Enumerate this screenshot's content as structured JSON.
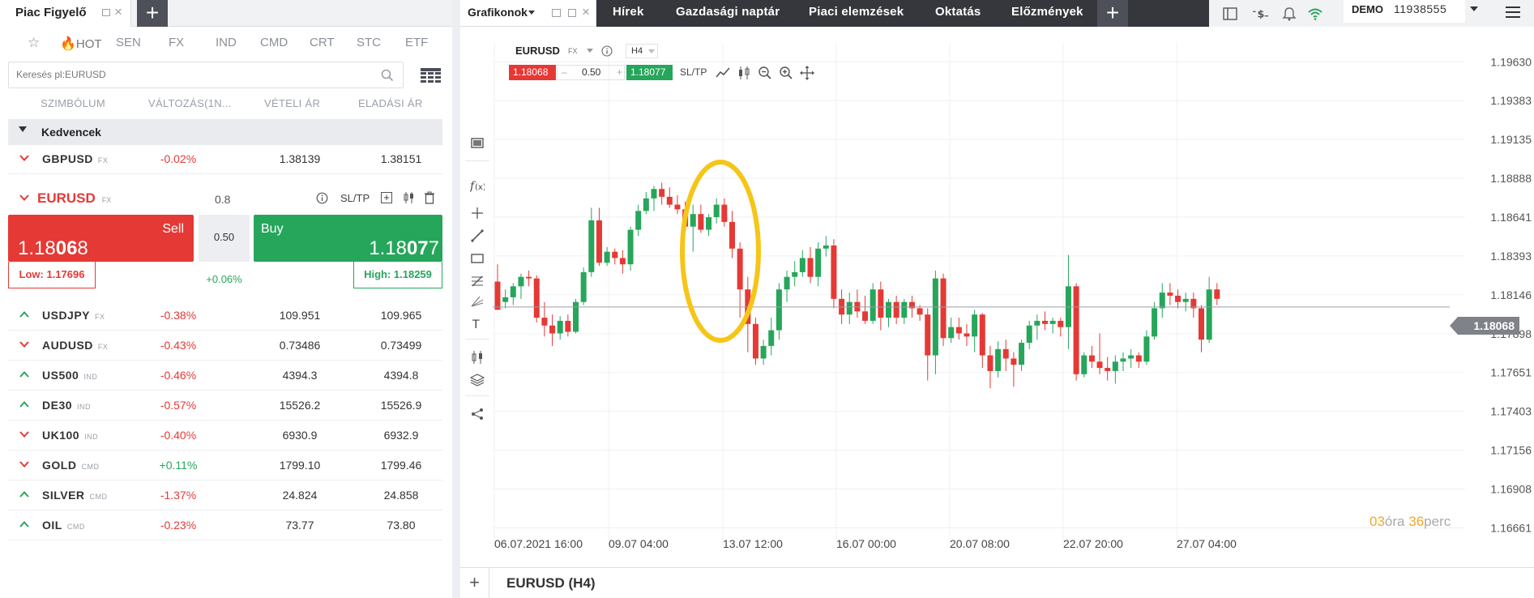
{
  "watchlist": {
    "title": "Piac Figyelő",
    "tabs": [
      "HOT",
      "SEN",
      "FX",
      "IND",
      "CMD",
      "CRT",
      "STC",
      "ETF"
    ],
    "search_placeholder": "Keresés pl:EURUSD",
    "columns": [
      "SZIMBÓLUM",
      "VÁLTOZÁS(1N...",
      "VÉTELI ÁR",
      "ELADÁSI ÁR"
    ],
    "group": "Kedvencek",
    "favorites": [
      {
        "symbol": "GBPUSD",
        "type": "FX",
        "change": "-0.02%",
        "bid": "1.38139",
        "ask": "1.38151",
        "dir": "down"
      }
    ],
    "expanded": {
      "symbol": "EURUSD",
      "type": "FX",
      "spread": "0.8",
      "sltp": "SL/TP",
      "sell_label": "Sell",
      "sell_price_pre": "1.18",
      "sell_price_big": "06",
      "sell_price_post": "8",
      "lot": "0.50",
      "buy_label": "Buy",
      "buy_price_pre": "1.18",
      "buy_price_big": "07",
      "buy_price_post": "7",
      "low": "Low: 1.17696",
      "high": "High: 1.18259",
      "change": "+0.06%"
    },
    "rows": [
      {
        "symbol": "USDJPY",
        "type": "FX",
        "change": "-0.38%",
        "bid": "109.951",
        "ask": "109.965",
        "dir": "up"
      },
      {
        "symbol": "AUDUSD",
        "type": "FX",
        "change": "-0.43%",
        "bid": "0.73486",
        "ask": "0.73499",
        "dir": "down"
      },
      {
        "symbol": "US500",
        "type": "IND",
        "change": "-0.46%",
        "bid": "4394.3",
        "ask": "4394.8",
        "dir": "up"
      },
      {
        "symbol": "DE30",
        "type": "IND",
        "change": "-0.57%",
        "bid": "15526.2",
        "ask": "15526.9",
        "dir": "up"
      },
      {
        "symbol": "UK100",
        "type": "IND",
        "change": "-0.40%",
        "bid": "6930.9",
        "ask": "6932.9",
        "dir": "down"
      },
      {
        "symbol": "GOLD",
        "type": "CMD",
        "change": "+0.11%",
        "bid": "1799.10",
        "ask": "1799.46",
        "dir": "down"
      },
      {
        "symbol": "SILVER",
        "type": "CMD",
        "change": "-1.37%",
        "bid": "24.824",
        "ask": "24.858",
        "dir": "up"
      },
      {
        "symbol": "OIL",
        "type": "CMD",
        "change": "-0.23%",
        "bid": "73.77",
        "ask": "73.80",
        "dir": "up"
      }
    ]
  },
  "topbar": {
    "tab_title": "Grafikonok",
    "nav": [
      "Hírek",
      "Gazdasági naptár",
      "Piaci elemzések",
      "Oktatás",
      "Előzmények"
    ],
    "account_label": "DEMO",
    "account_number": "11938555"
  },
  "chart_header": {
    "symbol": "EURUSD",
    "type": "FX",
    "timeframe": "H4",
    "sell": "1.18068",
    "lot": "0.50",
    "buy": "1.18077",
    "sltp": "SL/TP"
  },
  "chart_footer": {
    "title": "EURUSD (H4)",
    "countdown_h": "03",
    "countdown_h_label": "óra",
    "countdown_m": "36",
    "countdown_m_label": "perc"
  },
  "colors": {
    "up": "#26a65b",
    "down": "#e53935",
    "highlight": "#f5c518"
  },
  "chart_data": {
    "type": "candlestick",
    "ylim": [
      1.1655,
      1.1975
    ],
    "y_ticks": [
      "1.19630",
      "1.19383",
      "1.19135",
      "1.18888",
      "1.18641",
      "1.18393",
      "1.18146",
      "1.17898",
      "1.17651",
      "1.17403",
      "1.17156",
      "1.16908",
      "1.16661"
    ],
    "x_ticks": [
      "06.07.2021 16:00",
      "09.07 04:00",
      "13.07 12:00",
      "16.07 00:00",
      "20.07 08:00",
      "22.07 20:00",
      "27.07 04:00"
    ],
    "current_price": "1.18068",
    "current_value": 1.18068,
    "candles": [
      [
        1.1823,
        1.1834,
        1.1808,
        1.1805
      ],
      [
        1.181,
        1.1818,
        1.1806,
        1.1813
      ],
      [
        1.1813,
        1.1822,
        1.1808,
        1.182
      ],
      [
        1.182,
        1.1828,
        1.1812,
        1.1826
      ],
      [
        1.1826,
        1.183,
        1.182,
        1.1825
      ],
      [
        1.1825,
        1.1827,
        1.1797,
        1.18
      ],
      [
        1.18,
        1.181,
        1.1788,
        1.1795
      ],
      [
        1.1795,
        1.1802,
        1.1782,
        1.179
      ],
      [
        1.179,
        1.1801,
        1.1786,
        1.1798
      ],
      [
        1.1798,
        1.1802,
        1.1788,
        1.1791
      ],
      [
        1.1791,
        1.1812,
        1.179,
        1.181
      ],
      [
        1.181,
        1.1832,
        1.1808,
        1.1829
      ],
      [
        1.1829,
        1.187,
        1.1826,
        1.1862
      ],
      [
        1.1862,
        1.187,
        1.1833,
        1.1835
      ],
      [
        1.1835,
        1.1845,
        1.1833,
        1.1842
      ],
      [
        1.1842,
        1.1844,
        1.1834,
        1.1838
      ],
      [
        1.1838,
        1.1843,
        1.1828,
        1.1834
      ],
      [
        1.1834,
        1.1858,
        1.183,
        1.1856
      ],
      [
        1.1856,
        1.1872,
        1.1852,
        1.1868
      ],
      [
        1.1868,
        1.188,
        1.1866,
        1.1876
      ],
      [
        1.1876,
        1.1884,
        1.1868,
        1.1882
      ],
      [
        1.1882,
        1.1886,
        1.1872,
        1.1877
      ],
      [
        1.1877,
        1.1883,
        1.187,
        1.1872
      ],
      [
        1.1872,
        1.1878,
        1.1866,
        1.1869
      ],
      [
        1.1869,
        1.1874,
        1.1856,
        1.1858
      ],
      [
        1.1858,
        1.1872,
        1.1842,
        1.1866
      ],
      [
        1.1866,
        1.1872,
        1.1854,
        1.1856
      ],
      [
        1.1856,
        1.1866,
        1.1852,
        1.1864
      ],
      [
        1.1864,
        1.1876,
        1.186,
        1.1872
      ],
      [
        1.1872,
        1.1876,
        1.1858,
        1.1861
      ],
      [
        1.1861,
        1.1868,
        1.1838,
        1.1844
      ],
      [
        1.1844,
        1.1848,
        1.18,
        1.1818
      ],
      [
        1.1818,
        1.1826,
        1.1778,
        1.1796
      ],
      [
        1.1796,
        1.18,
        1.177,
        1.1774
      ],
      [
        1.1774,
        1.1786,
        1.177,
        1.1782
      ],
      [
        1.1782,
        1.18,
        1.1776,
        1.1792
      ],
      [
        1.1792,
        1.1822,
        1.1786,
        1.1818
      ],
      [
        1.1818,
        1.183,
        1.181,
        1.1826
      ],
      [
        1.1826,
        1.1836,
        1.182,
        1.1829
      ],
      [
        1.1829,
        1.1843,
        1.1826,
        1.1838
      ],
      [
        1.1838,
        1.1845,
        1.1822,
        1.1826
      ],
      [
        1.1826,
        1.1848,
        1.182,
        1.1844
      ],
      [
        1.1844,
        1.1852,
        1.1839,
        1.1846
      ],
      [
        1.1846,
        1.185,
        1.1806,
        1.1812
      ],
      [
        1.1812,
        1.1818,
        1.1796,
        1.1802
      ],
      [
        1.1802,
        1.1816,
        1.1796,
        1.181
      ],
      [
        1.181,
        1.1818,
        1.18,
        1.1804
      ],
      [
        1.1804,
        1.1814,
        1.1796,
        1.1798
      ],
      [
        1.1798,
        1.1822,
        1.1796,
        1.1818
      ],
      [
        1.1818,
        1.1823,
        1.1792,
        1.18
      ],
      [
        1.18,
        1.1812,
        1.1794,
        1.181
      ],
      [
        1.181,
        1.1814,
        1.1796,
        1.18
      ],
      [
        1.18,
        1.1812,
        1.1796,
        1.181
      ],
      [
        1.181,
        1.1814,
        1.18,
        1.1806
      ],
      [
        1.1806,
        1.1808,
        1.1798,
        1.1802
      ],
      [
        1.1802,
        1.1806,
        1.176,
        1.1776
      ],
      [
        1.1776,
        1.183,
        1.1764,
        1.1825
      ],
      [
        1.1825,
        1.1828,
        1.1782,
        1.1787
      ],
      [
        1.1787,
        1.18,
        1.1784,
        1.1794
      ],
      [
        1.1794,
        1.18,
        1.1786,
        1.179
      ],
      [
        1.179,
        1.1796,
        1.1782,
        1.1788
      ],
      [
        1.1788,
        1.1805,
        1.1778,
        1.1802
      ],
      [
        1.1802,
        1.1803,
        1.1768,
        1.1776
      ],
      [
        1.1776,
        1.1782,
        1.1755,
        1.1766
      ],
      [
        1.1766,
        1.1785,
        1.1762,
        1.178
      ],
      [
        1.178,
        1.1786,
        1.1766,
        1.1774
      ],
      [
        1.1774,
        1.1778,
        1.1756,
        1.177
      ],
      [
        1.177,
        1.1786,
        1.1766,
        1.1784
      ],
      [
        1.1784,
        1.1798,
        1.178,
        1.1795
      ],
      [
        1.1795,
        1.1802,
        1.1786,
        1.1798
      ],
      [
        1.1798,
        1.1804,
        1.1792,
        1.1796
      ],
      [
        1.1796,
        1.18,
        1.179,
        1.1798
      ],
      [
        1.1798,
        1.18,
        1.1788,
        1.1794
      ],
      [
        1.1794,
        1.184,
        1.178,
        1.182
      ],
      [
        1.182,
        1.1822,
        1.176,
        1.1764
      ],
      [
        1.1764,
        1.1778,
        1.1762,
        1.1776
      ],
      [
        1.1776,
        1.1782,
        1.1768,
        1.1772
      ],
      [
        1.1772,
        1.179,
        1.1764,
        1.1768
      ],
      [
        1.1768,
        1.1775,
        1.176,
        1.1766
      ],
      [
        1.1766,
        1.1776,
        1.1758,
        1.1772
      ],
      [
        1.1772,
        1.1778,
        1.1766,
        1.1774
      ],
      [
        1.1774,
        1.178,
        1.1768,
        1.1776
      ],
      [
        1.1776,
        1.1778,
        1.1768,
        1.1772
      ],
      [
        1.1772,
        1.1792,
        1.177,
        1.1788
      ],
      [
        1.1788,
        1.181,
        1.1786,
        1.1806
      ],
      [
        1.1806,
        1.1822,
        1.18,
        1.1816
      ],
      [
        1.1816,
        1.1822,
        1.1808,
        1.1814
      ],
      [
        1.1814,
        1.1818,
        1.1806,
        1.181
      ],
      [
        1.181,
        1.1816,
        1.1804,
        1.1812
      ],
      [
        1.1812,
        1.1816,
        1.18,
        1.1806
      ],
      [
        1.1806,
        1.1808,
        1.1778,
        1.1786
      ],
      [
        1.1786,
        1.1826,
        1.1784,
        1.1818
      ],
      [
        1.1818,
        1.1822,
        1.1808,
        1.1812
      ]
    ]
  }
}
